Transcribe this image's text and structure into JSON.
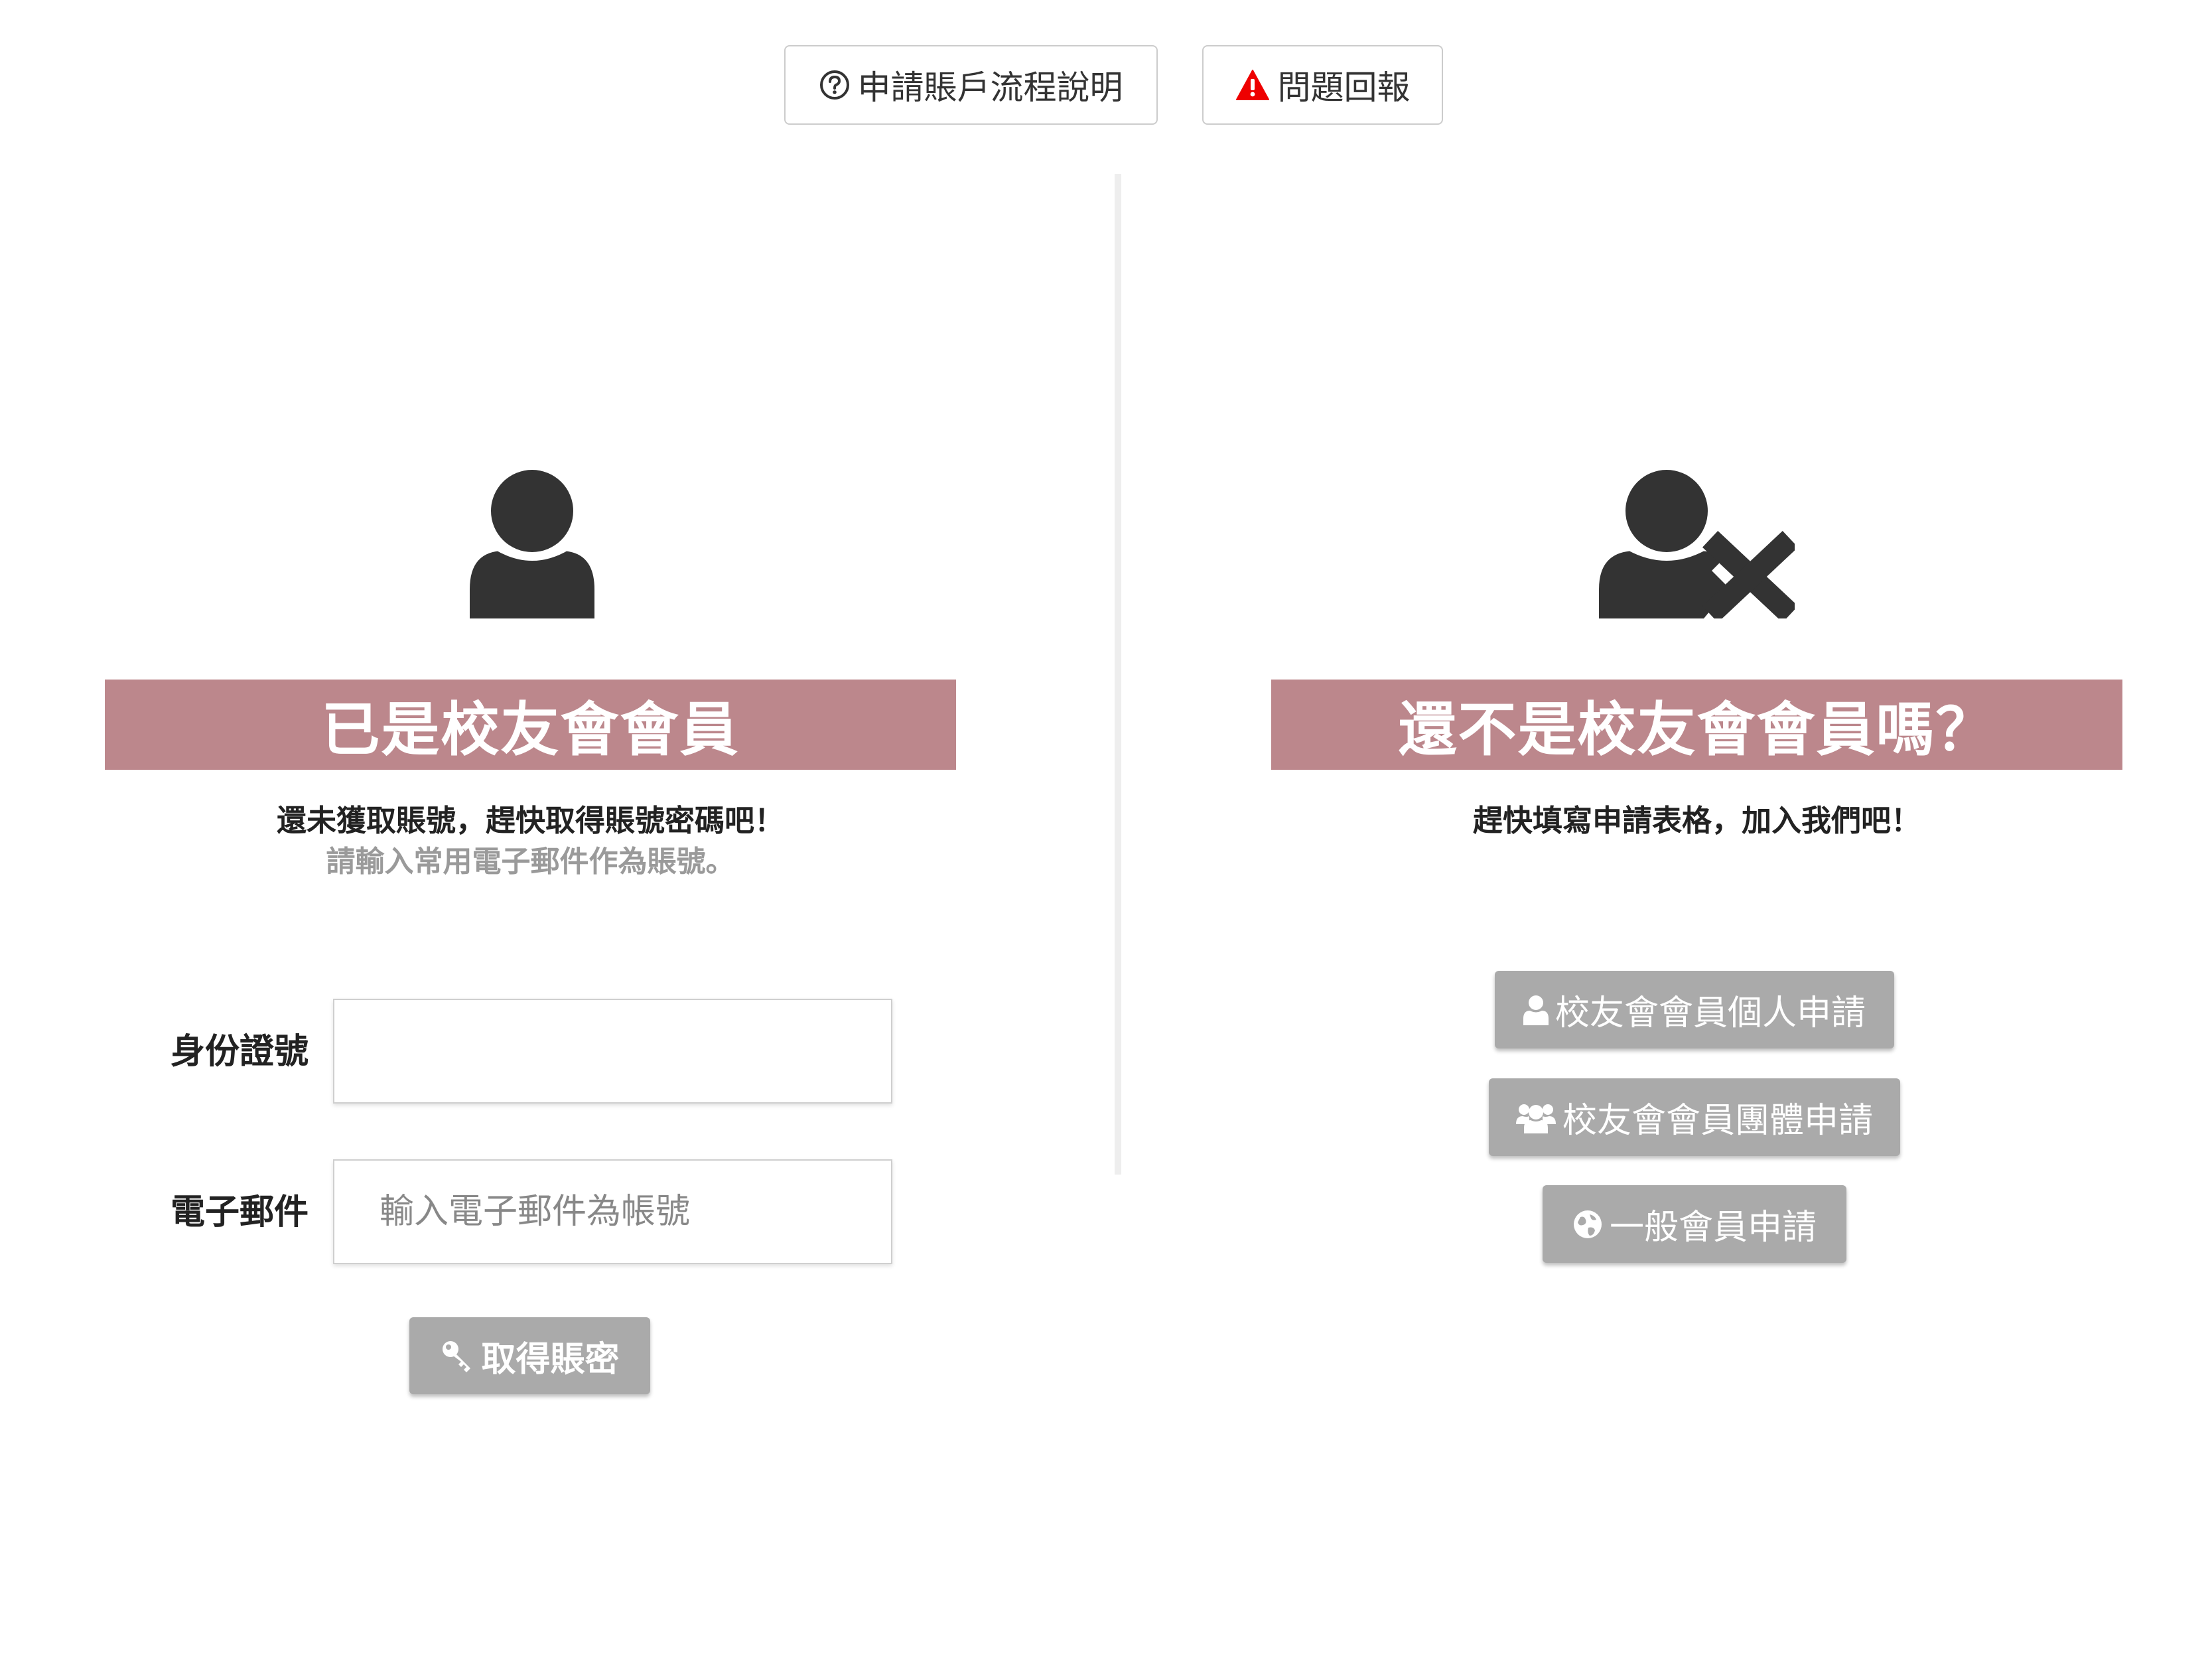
{
  "top_buttons": {
    "guide_label": "申請賬戶流程說明",
    "report_label": "問題回報"
  },
  "member_panel": {
    "title": "已是校友會會員",
    "subtitle": "還未獲取賬號，趕快取得賬號密碼吧！",
    "hint": "請輸入常用電子郵件作為賬號。",
    "form": {
      "id_label": "身份證號",
      "id_value": "",
      "email_label": "電子郵件",
      "email_placeholder": "輸入電子郵件為帳號",
      "submit_label": "取得賬密"
    }
  },
  "nonmember_panel": {
    "title": "還不是校友會會員嗎？",
    "subtitle": "趕快填寫申請表格，加入我們吧！",
    "buttons": {
      "personal": "校友會會員個人申請",
      "group": "校友會會員團體申請",
      "general": "一般會員申請"
    }
  },
  "icons": {
    "guide": "question-circle-icon",
    "report": "warning-triangle-icon",
    "member": "user-icon",
    "nonmember": "user-times-icon",
    "get_account": "key-icon",
    "personal": "user-icon",
    "group": "users-icon",
    "general": "globe-icon"
  },
  "colors": {
    "banner": "#bc878c",
    "button_gray": "#aaaaaa",
    "icon_dark": "#333333",
    "warning_red": "#ee0000"
  }
}
